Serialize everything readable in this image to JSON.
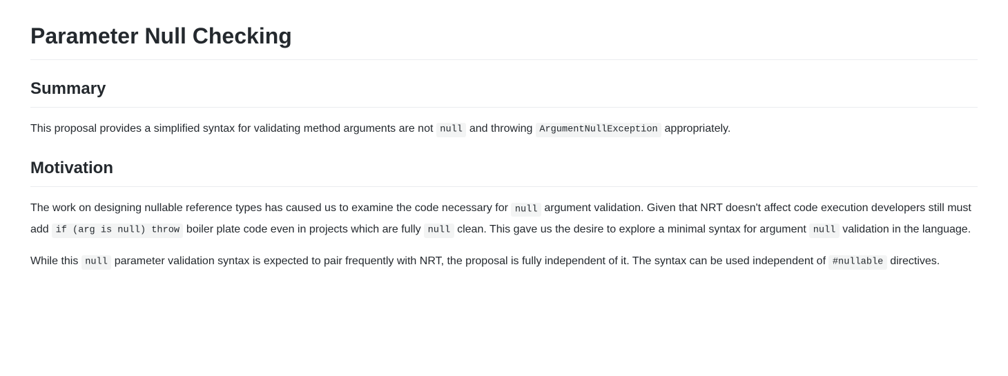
{
  "title": "Parameter Null Checking",
  "sections": {
    "summary": {
      "heading": "Summary",
      "p1": {
        "t1": "This proposal provides a simplified syntax for validating method arguments are not ",
        "c1": "null",
        "t2": " and throwing ",
        "c2": "ArgumentNullException",
        "t3": " appropriately."
      }
    },
    "motivation": {
      "heading": "Motivation",
      "p1": {
        "t1": "The work on designing nullable reference types has caused us to examine the code necessary for ",
        "c1": "null",
        "t2": " argument validation. Given that NRT doesn't affect code execution developers still must add ",
        "c2": "if (arg is null) throw",
        "t3": " boiler plate code even in projects which are fully ",
        "c3": "null",
        "t4": " clean. This gave us the desire to explore a minimal syntax for argument ",
        "c4": "null",
        "t5": " validation in the language."
      },
      "p2": {
        "t1": "While this ",
        "c1": "null",
        "t2": " parameter validation syntax is expected to pair frequently with NRT, the proposal is fully independent of it. The syntax can be used independent of ",
        "c2": "#nullable",
        "t3": " directives."
      }
    }
  }
}
